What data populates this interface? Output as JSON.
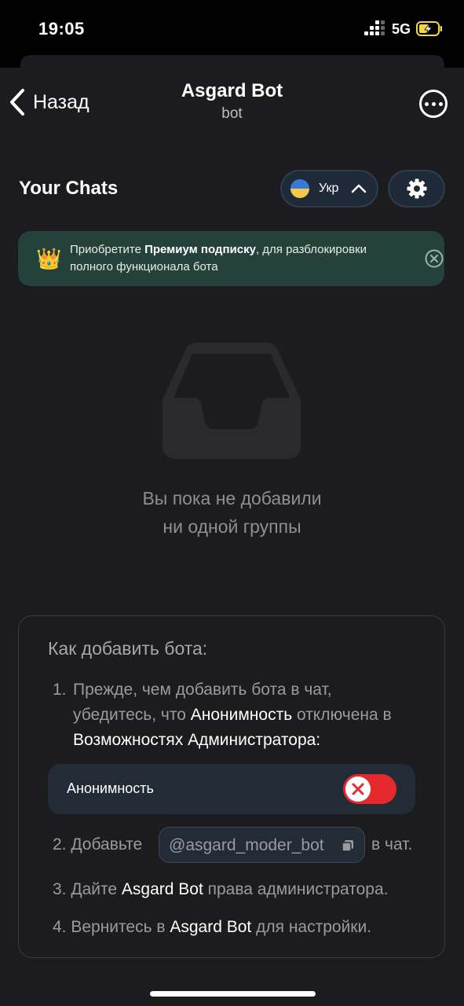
{
  "status_bar": {
    "time": "19:05",
    "network": "5G"
  },
  "nav": {
    "back_label": "Назад",
    "title": "Asgard Bot",
    "subtitle": "bot"
  },
  "header": {
    "chats_title": "Your Chats",
    "language": "Укр"
  },
  "premium_banner": {
    "text_before": "Приобретите ",
    "text_bold": "Премиум подписку",
    "text_after": ", для разблокировки полного функционала бота",
    "icon": "crown-icon"
  },
  "empty_state": {
    "line1": "Вы пока не добавили",
    "line2": "ни одной группы",
    "icon": "inbox-icon"
  },
  "howto": {
    "heading": "Как добавить бота:",
    "step1": {
      "num": "1.",
      "t1": "Прежде, чем добавить бота в чат, убедитесь, что ",
      "hl1": "Анонимность",
      "t2": " отключена в ",
      "hl2": "Возможностях Администратора:"
    },
    "anon_toggle": {
      "label": "Анонимность",
      "state": "off"
    },
    "step2": {
      "before": "2. Добавьте",
      "bot_username": "@asgard_moder_bot",
      "after": "в чат."
    },
    "step3": {
      "before": "3. Дайте ",
      "hl": "Asgard Bot",
      "after": " права администратора."
    },
    "step4": {
      "before": "4. Вернитесь в ",
      "hl": "Asgard Bot",
      "after": " для настройки."
    }
  },
  "colors": {
    "sheet_bg": "#1c1c1e",
    "premium_bg": "#24423a",
    "toggle_off": "#e5292c",
    "chip_bg": "#232b36"
  }
}
